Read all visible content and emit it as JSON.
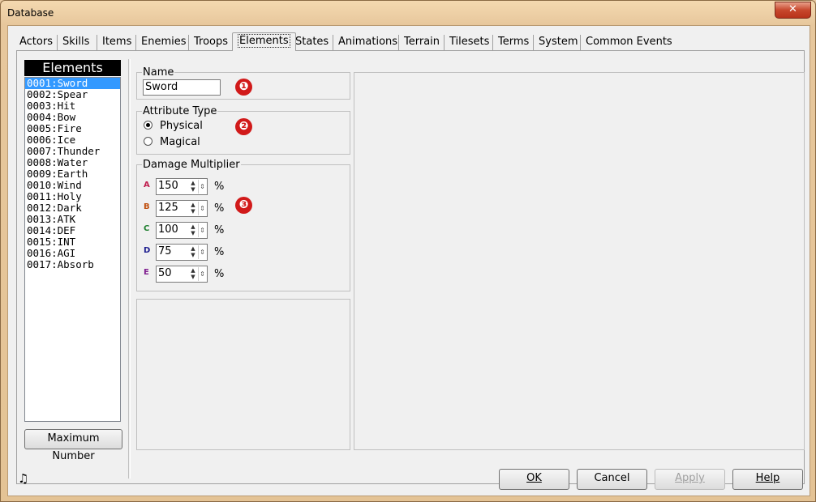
{
  "window": {
    "title": "Database",
    "close": "✕"
  },
  "tabs": [
    "Actors",
    "Skills",
    "Items",
    "Enemies",
    "Troops",
    "Elements",
    "States",
    "Animations",
    "Terrain",
    "Tilesets",
    "Terms",
    "System",
    "Common Events"
  ],
  "sidebar": {
    "header": "Elements",
    "items": [
      "0001:Sword",
      "0002:Spear",
      "0003:Hit",
      "0004:Bow",
      "0005:Fire",
      "0006:Ice",
      "0007:Thunder",
      "0008:Water",
      "0009:Earth",
      "0010:Wind",
      "0011:Holy",
      "0012:Dark",
      "0013:ATK",
      "0014:DEF",
      "0015:INT",
      "0016:AGI",
      "0017:Absorb"
    ],
    "max_button": "Maximum Number"
  },
  "name_group": {
    "label": "Name",
    "value": "Sword"
  },
  "attribute_group": {
    "label": "Attribute Type",
    "options": [
      "Physical",
      "Magical"
    ]
  },
  "damage_group": {
    "label": "Damage Multiplier",
    "rows": [
      {
        "letter": "A",
        "value": "150",
        "unit": "%"
      },
      {
        "letter": "B",
        "value": "125",
        "unit": "%"
      },
      {
        "letter": "C",
        "value": "100",
        "unit": "%"
      },
      {
        "letter": "D",
        "value": "75",
        "unit": "%"
      },
      {
        "letter": "E",
        "value": "50",
        "unit": "%"
      }
    ]
  },
  "badges": [
    "❶",
    "❷",
    "❸"
  ],
  "footer": {
    "ok": "OK",
    "cancel": "Cancel",
    "apply": "Apply",
    "help": "Help"
  },
  "colors": {
    "selection": "#3399ff",
    "badge": "#d11a1a"
  },
  "icons": {
    "music": "music-note-icon"
  }
}
